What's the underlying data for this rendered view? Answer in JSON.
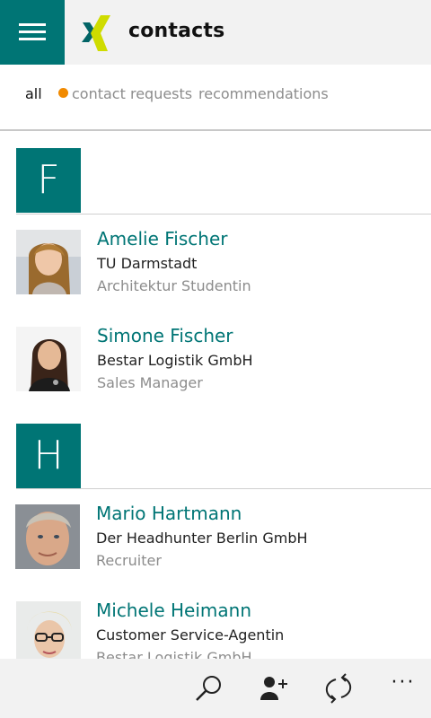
{
  "header": {
    "title": "contacts",
    "menu_icon": "hamburger-icon",
    "logo": "xing-logo",
    "accent_color": "#007575",
    "logo_colors": [
      "#026466",
      "#cfdc00"
    ]
  },
  "tabs": [
    {
      "label": "all",
      "active": true
    },
    {
      "label": "contact requests",
      "active": false,
      "badge_color": "#f18a00"
    },
    {
      "label": "recommendations",
      "active": false
    }
  ],
  "groups": [
    {
      "letter": "F",
      "contacts": [
        {
          "name": "Amelie Fischer",
          "company": "TU Darmstadt",
          "role": "Architektur Studentin"
        },
        {
          "name": "Simone Fischer",
          "company": "Bestar Logistik GmbH",
          "role": "Sales Manager"
        }
      ]
    },
    {
      "letter": "H",
      "contacts": [
        {
          "name": "Mario Hartmann",
          "company": "Der Headhunter Berlin GmbH",
          "role": "Recruiter"
        },
        {
          "name": "Michele Heimann",
          "company": "Customer Service-Agentin",
          "role": "Bestar Logistik GmbH"
        }
      ]
    }
  ],
  "appbar": {
    "buttons": [
      "search-icon",
      "add-contact-icon",
      "sync-icon",
      "more-icon"
    ],
    "more_label": "···"
  }
}
